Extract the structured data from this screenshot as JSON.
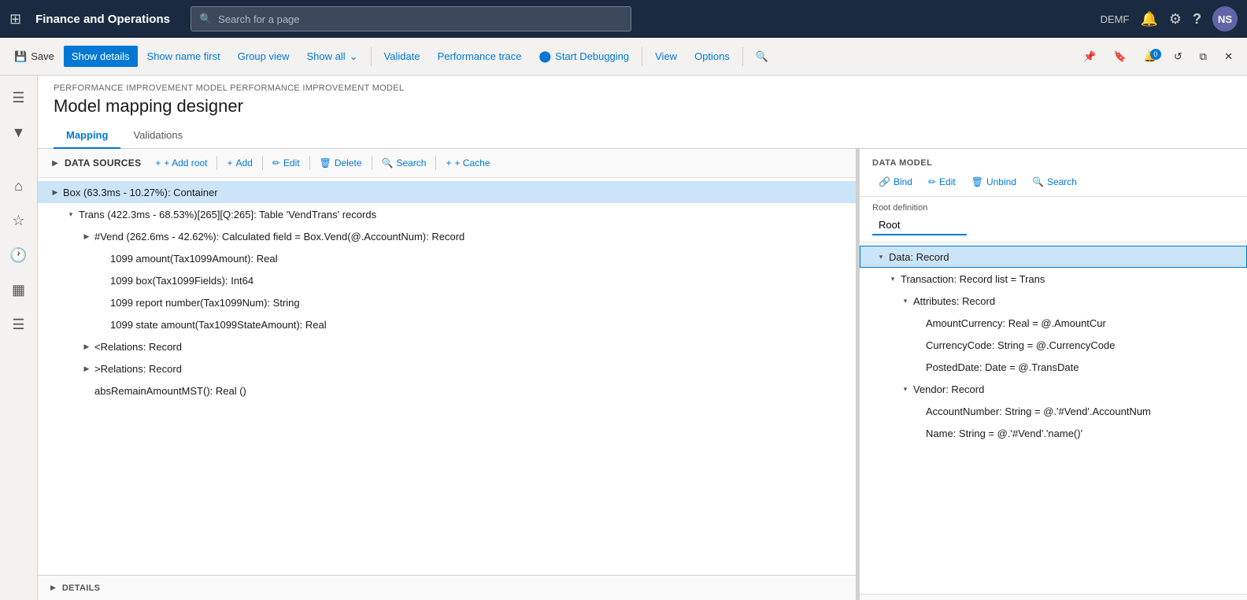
{
  "app": {
    "title": "Finance and Operations",
    "search_placeholder": "Search for a page",
    "env": "DEMF"
  },
  "toolbar": {
    "save_label": "Save",
    "show_details_label": "Show details",
    "show_name_first_label": "Show name first",
    "group_view_label": "Group view",
    "show_all_label": "Show all",
    "validate_label": "Validate",
    "performance_trace_label": "Performance trace",
    "start_debugging_label": "Start Debugging",
    "view_label": "View",
    "options_label": "Options"
  },
  "breadcrumb": "PERFORMANCE IMPROVEMENT MODEL PERFORMANCE IMPROVEMENT MODEL",
  "page_title": "Model mapping designer",
  "tabs": [
    {
      "id": "mapping",
      "label": "Mapping",
      "active": true
    },
    {
      "id": "validations",
      "label": "Validations",
      "active": false
    }
  ],
  "data_sources": {
    "section_title": "DATA SOURCES",
    "actions": {
      "add_root": "+ Add root",
      "add": "+ Add",
      "edit": "Edit",
      "delete": "Delete",
      "search": "Search",
      "cache": "+ Cache"
    },
    "tree": [
      {
        "id": "box",
        "text": "Box (63.3ms - 10.27%): Container",
        "indent": 1,
        "expanded": true,
        "selected": true,
        "has_children": true
      },
      {
        "id": "trans",
        "text": "Trans (422.3ms - 68.53%)[265][Q:265]: Table 'VendTrans' records",
        "indent": 2,
        "expanded": true,
        "selected": false,
        "has_children": true
      },
      {
        "id": "vend",
        "text": "#Vend (262.6ms - 42.62%): Calculated field = Box.Vend(@.AccountNum): Record",
        "indent": 3,
        "expanded": false,
        "selected": false,
        "has_children": true
      },
      {
        "id": "tax1099amount",
        "text": "1099 amount(Tax1099Amount): Real",
        "indent": 4,
        "expanded": false,
        "selected": false,
        "has_children": false
      },
      {
        "id": "tax1099fields",
        "text": "1099 box(Tax1099Fields): Int64",
        "indent": 4,
        "expanded": false,
        "selected": false,
        "has_children": false
      },
      {
        "id": "tax1099num",
        "text": "1099 report number(Tax1099Num): String",
        "indent": 4,
        "expanded": false,
        "selected": false,
        "has_children": false
      },
      {
        "id": "tax1099state",
        "text": "1099 state amount(Tax1099StateAmount): Real",
        "indent": 4,
        "expanded": false,
        "selected": false,
        "has_children": false
      },
      {
        "id": "relations_lt",
        "text": "<Relations: Record",
        "indent": 3,
        "expanded": false,
        "selected": false,
        "has_children": true
      },
      {
        "id": "relations_gt",
        "text": ">Relations: Record",
        "indent": 3,
        "expanded": false,
        "selected": false,
        "has_children": true
      },
      {
        "id": "absremain",
        "text": "absRemainAmountMST(): Real ()",
        "indent": 3,
        "expanded": false,
        "selected": false,
        "has_children": false
      }
    ]
  },
  "data_model": {
    "section_title": "DATA MODEL",
    "actions": {
      "bind": "Bind",
      "edit": "Edit",
      "unbind": "Unbind",
      "search": "Search"
    },
    "root_definition_label": "Root definition",
    "root_value": "Root",
    "tree": [
      {
        "id": "data_record",
        "text": "Data: Record",
        "indent": 1,
        "expanded": true,
        "selected": true,
        "has_children": true
      },
      {
        "id": "transaction",
        "text": "Transaction: Record list = Trans",
        "indent": 2,
        "expanded": true,
        "selected": false,
        "has_children": true
      },
      {
        "id": "attributes",
        "text": "Attributes: Record",
        "indent": 3,
        "expanded": true,
        "selected": false,
        "has_children": true
      },
      {
        "id": "amount_currency",
        "text": "AmountCurrency: Real = @.AmountCur",
        "indent": 4,
        "expanded": false,
        "selected": false,
        "has_children": false
      },
      {
        "id": "currency_code",
        "text": "CurrencyCode: String = @.CurrencyCode",
        "indent": 4,
        "expanded": false,
        "selected": false,
        "has_children": false
      },
      {
        "id": "posted_date",
        "text": "PostedDate: Date = @.TransDate",
        "indent": 4,
        "expanded": false,
        "selected": false,
        "has_children": false
      },
      {
        "id": "vendor",
        "text": "Vendor: Record",
        "indent": 3,
        "expanded": true,
        "selected": false,
        "has_children": true
      },
      {
        "id": "account_number",
        "text": "AccountNumber: String = @.'#Vend'.AccountNum",
        "indent": 4,
        "expanded": false,
        "selected": false,
        "has_children": false
      },
      {
        "id": "name",
        "text": "Name: String = @.'#Vend'.'name()'",
        "indent": 4,
        "expanded": false,
        "selected": false,
        "has_children": false
      }
    ]
  },
  "details_bar": {
    "label": "DETAILS"
  },
  "icons": {
    "grid": "⊞",
    "save": "💾",
    "search": "🔍",
    "filter": "▼",
    "home": "⌂",
    "star": "★",
    "clock": "🕐",
    "table": "▦",
    "list": "☰",
    "bell": "🔔",
    "gear": "⚙",
    "question": "?",
    "expand_right": "▶",
    "expand_down": "▼",
    "collapse": "◀",
    "link": "🔗",
    "pencil": "✏",
    "trash": "🗑",
    "bind": "🔗",
    "plus": "+",
    "minus": "-",
    "close": "✕",
    "chevron_right": "›",
    "chevron_down": "⌄",
    "triangle_right": "▶",
    "triangle_down": "▾",
    "triangle_down_small": "▴"
  }
}
